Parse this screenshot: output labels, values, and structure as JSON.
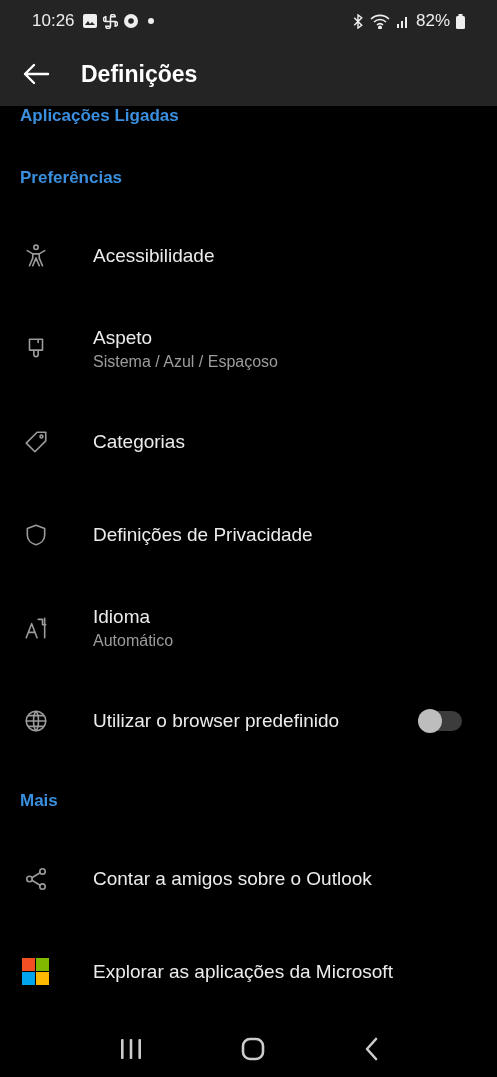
{
  "status_bar": {
    "time": "10:26",
    "battery": "82%"
  },
  "app_bar": {
    "title": "Definições"
  },
  "sections": [
    {
      "title": "Aplicações Ligadas"
    },
    {
      "title": "Preferências",
      "items": [
        {
          "kind": "link",
          "title": "Acessibilidade"
        },
        {
          "kind": "link",
          "title": "Aspeto",
          "subtitle": "Sistema / Azul / Espaçoso"
        },
        {
          "kind": "link",
          "title": "Categorias"
        },
        {
          "kind": "link",
          "title": "Definições de Privacidade"
        },
        {
          "kind": "link",
          "title": "Idioma",
          "subtitle": "Automático"
        },
        {
          "kind": "toggle",
          "title": "Utilizar o browser predefinido",
          "on": false
        }
      ]
    },
    {
      "title": "Mais",
      "items": [
        {
          "kind": "link",
          "title": "Contar a amigos sobre o Outlook"
        },
        {
          "kind": "link",
          "title": "Explorar as aplicações da Microsoft"
        }
      ]
    }
  ]
}
